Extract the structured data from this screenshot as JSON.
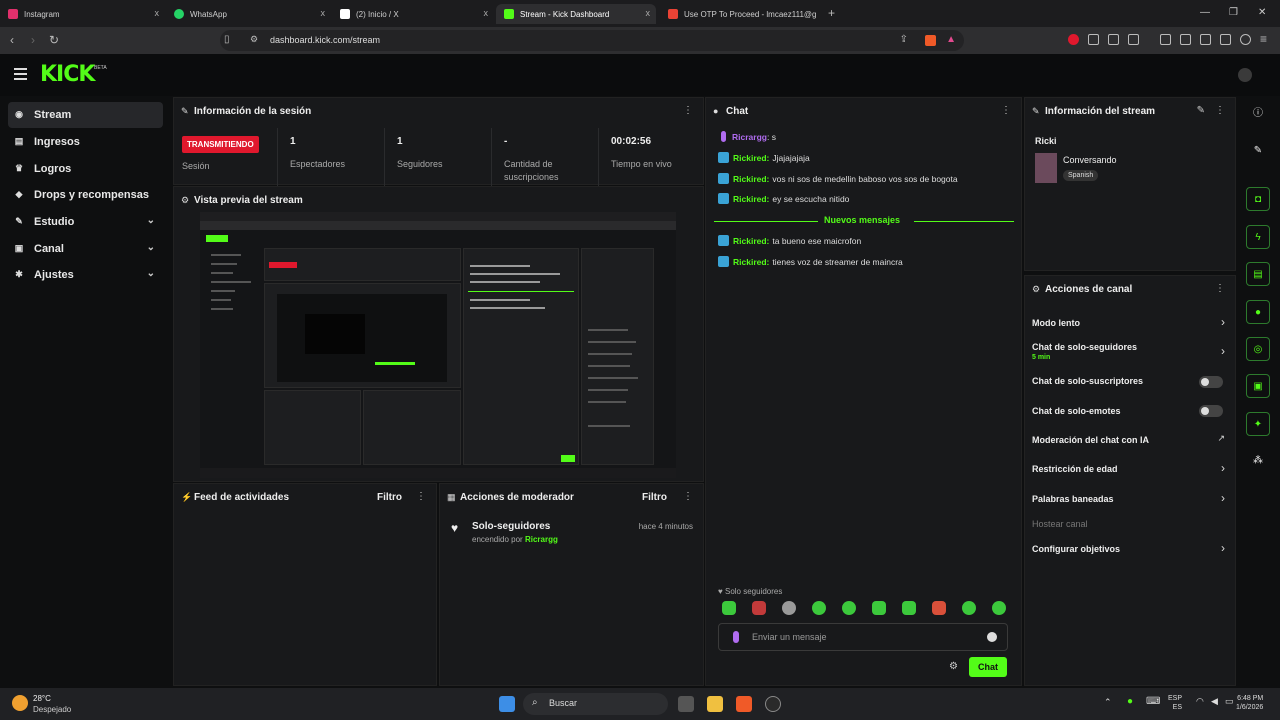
{
  "browser": {
    "tabs": [
      {
        "label": "Instagram",
        "color": "#e1306c"
      },
      {
        "label": "WhatsApp",
        "color": "#25d366"
      },
      {
        "label": "(2) Inicio / X",
        "color": "#ffffff"
      },
      {
        "label": "Stream - Kick Dashboard",
        "color": "#53fc18"
      },
      {
        "label": "Use OTP To Proceed - lmcaez111@g",
        "color": "#ea4335"
      }
    ],
    "close_glyph": "x",
    "new_tab_glyph": "+",
    "url": "dashboard.kick.com/stream"
  },
  "kick": {
    "logo": "KICK",
    "beta": "BETA"
  },
  "sidebar": {
    "items": [
      {
        "label": "Stream",
        "icon": "broadcast-icon"
      },
      {
        "label": "Ingresos",
        "icon": "revenue-icon"
      },
      {
        "label": "Logros",
        "icon": "trophy-icon"
      },
      {
        "label": "Drops y recompensas",
        "icon": "gift-icon"
      },
      {
        "label": "Estudio",
        "icon": "studio-icon"
      },
      {
        "label": "Canal",
        "icon": "channel-icon"
      },
      {
        "label": "Ajustes",
        "icon": "settings-icon"
      }
    ]
  },
  "session": {
    "title": "Información de la sesión",
    "live_badge": "TRANSMITIENDO",
    "session_label": "Sesión",
    "stats": [
      {
        "value": "1",
        "label": "Espectadores"
      },
      {
        "value": "1",
        "label": "Seguidores"
      },
      {
        "value": "-",
        "label": "Cantidad de suscripciones"
      },
      {
        "value": "00:02:56",
        "label": "Tiempo en vivo"
      }
    ]
  },
  "preview": {
    "title": "Vista previa del stream"
  },
  "activity": {
    "title": "Feed de actividades",
    "filter": "Filtro"
  },
  "moderator": {
    "title": "Acciones de moderador",
    "filter": "Filtro",
    "entry_title": "Solo-seguidores",
    "entry_prefix": "encendido por",
    "entry_user": "Ricrargg",
    "entry_time": "hace 4 minutos"
  },
  "chat": {
    "title": "Chat",
    "messages": [
      {
        "user": "Ricrargg",
        "text": ": s",
        "purple": true
      },
      {
        "user": "Rickired:",
        "text": "Jjajajajaja"
      },
      {
        "user": "Rickired:",
        "text": "vos ni sos de medellin baboso vos sos de bogota"
      },
      {
        "user": "Rickired:",
        "text": "ey se escucha nitido"
      },
      {
        "user": "Rickired:",
        "text": "ta bueno ese maicrofon"
      },
      {
        "user": "Rickired:",
        "text": "tienes voz de streamer de maincra"
      }
    ],
    "new_messages": "Nuevos mensajes",
    "followers_only": "Solo seguidores",
    "input_placeholder": "Enviar un mensaje",
    "send_button": "Chat"
  },
  "stream_info": {
    "title": "Información del stream",
    "streamer": "Ricki",
    "category": "Conversando",
    "language": "Spanish"
  },
  "channel_actions": {
    "title": "Acciones de canal",
    "items": [
      {
        "label": "Modo lento",
        "control": "chevron"
      },
      {
        "label": "Chat de solo-seguidores",
        "sub": "5 min",
        "control": "chevron"
      },
      {
        "label": "Chat de solo-suscriptores",
        "control": "toggle"
      },
      {
        "label": "Chat de solo-emotes",
        "control": "toggle"
      },
      {
        "label": "Moderación del chat con IA",
        "control": "external"
      },
      {
        "label": "Restricción de edad",
        "control": "chevron"
      },
      {
        "label": "Palabras baneadas",
        "control": "chevron"
      },
      {
        "label": "Hostear canal",
        "control": "none",
        "disabled": true
      },
      {
        "label": "Configurar objetivos",
        "control": "chevron"
      }
    ]
  },
  "taskbar": {
    "weather_temp": "28°C",
    "weather_desc": "Despejado",
    "search": "Buscar",
    "lang_top": "ESP",
    "lang_bottom": "ES",
    "time": "6:48 PM",
    "date": "1/6/2026"
  },
  "colors": {
    "accent": "#53fc18",
    "live": "#e0182d",
    "panel": "#18191b"
  }
}
